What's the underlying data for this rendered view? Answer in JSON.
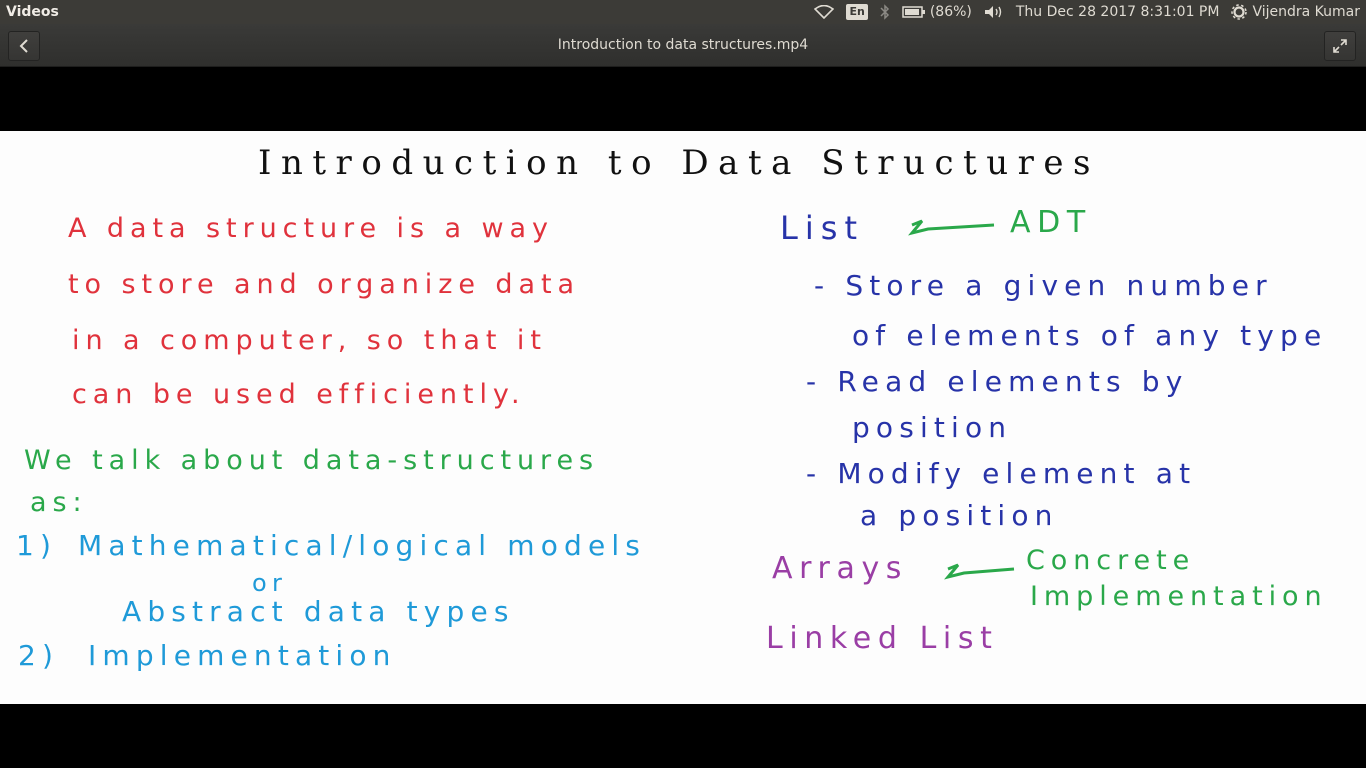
{
  "topbar": {
    "app_name": "Videos",
    "keyboard": "En",
    "battery": "(86%)",
    "datetime": "Thu Dec 28 2017  8:31:01 PM",
    "user": "Vijendra Kumar",
    "icons": [
      "wifi-icon",
      "bluetooth-icon",
      "battery-icon",
      "volume-icon",
      "gear-icon"
    ]
  },
  "header": {
    "title": "Introduction to data structures.mp4",
    "back_icon": "chevron-left-icon",
    "fullscreen_icon": "fullscreen-icon"
  },
  "slide": {
    "title": "Introduction to Data Structures",
    "definition": [
      "A data structure is a way",
      "to store and organize data",
      "in a computer, so that it",
      "can be used efficiently."
    ],
    "talk_line1": "We talk about data-structures",
    "talk_line2": "as:",
    "item1_num": "1)",
    "item1_text": "Mathematical/logical models",
    "item1_or": "or",
    "item1_sub": "Abstract data types",
    "item2_num": "2)",
    "item2_text": "Implementation",
    "list_label": "List",
    "list_adt": "ADT",
    "list_points": [
      "- Store a given number",
      "of elements of any type",
      "- Read elements by",
      "position",
      "- Modify element at",
      "a position"
    ],
    "arrays_label": "Arrays",
    "concrete_line1": "Concrete",
    "concrete_line2": "Implementation",
    "linked_list": "Linked List"
  },
  "colors": {
    "topbar_bg": "#3c3b37",
    "title_ink": "#111111",
    "red_ink": "#e0323c",
    "green_ink": "#2aa84a",
    "blue_ink": "#1f9ad8",
    "navy_ink": "#2733a8",
    "purple_ink": "#9a3ea5"
  }
}
